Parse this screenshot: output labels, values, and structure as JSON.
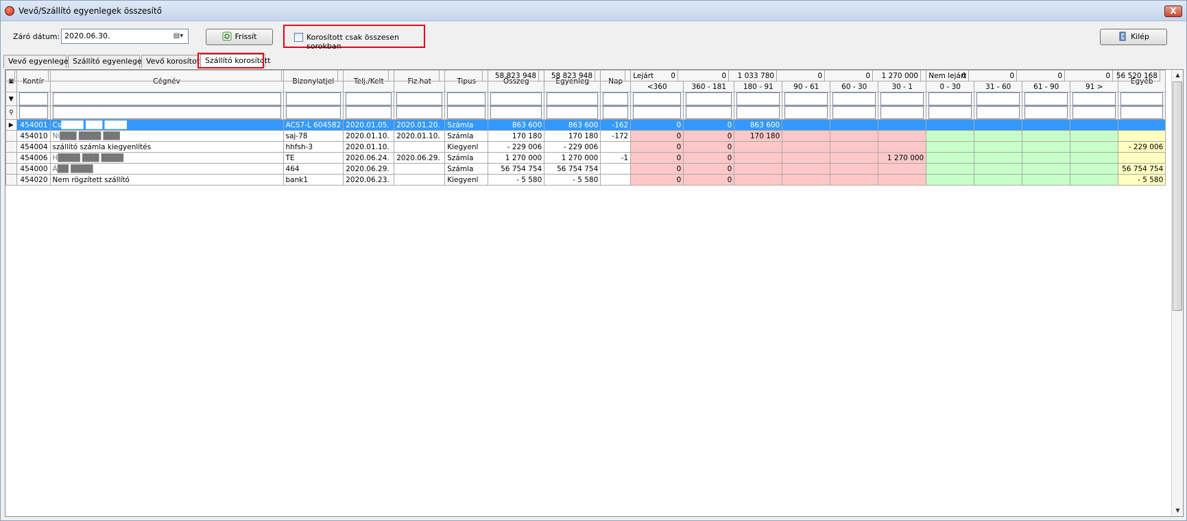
{
  "window": {
    "title": "Vevő/Szállító egyenlegek összesítő",
    "close_label": "X"
  },
  "toolbar": {
    "date_label": "Záró dátum:",
    "date_value": "2020.06.30.",
    "refresh_label": "Frissít",
    "checkbox_label": "Korosított csak összesen sorokban",
    "exit_label": "Kilép"
  },
  "tabs": [
    {
      "label": "Vevő egyenlegek"
    },
    {
      "label": "Szállító egyenlegek"
    },
    {
      "label": "Vevő korosított"
    },
    {
      "label": "Szállító korosított",
      "active": true
    }
  ],
  "grid": {
    "headers": {
      "kontir": "Kontír",
      "cegnev": "Cégnév",
      "bizonylatjel": "Bizonylatjel",
      "telj": "Telj./Kelt",
      "fizhat": "Fiz.hat",
      "tipus": "Tipus",
      "osszeg": "Összeg",
      "egyenleg": "Egyenleg",
      "nap": "Nap",
      "lejart": "Lejárt",
      "nemlejart": "Nem lejárt",
      "egyeb": "Egyéb",
      "l1": "<360",
      "l2": "360 - 181",
      "l3": "180 - 91",
      "l4": "90 - 61",
      "l5": "60 - 30",
      "l6": "30 - 1",
      "n1": "0 - 30",
      "n2": "31 - 60",
      "n3": "61 - 90",
      "n4": "91 >"
    },
    "rows": [
      [
        "454001",
        "Cs████ ███ ████",
        "ACS7-L 604582",
        "2020.01.05.",
        "2020.01.20.",
        "Számla",
        "863 600",
        "863 600",
        "-162",
        "0",
        "0",
        "863 600",
        "",
        "",
        "",
        "",
        "",
        "",
        "",
        ""
      ],
      [
        "454010",
        "Ni███ ████ ███",
        "saj-78",
        "2020.01.10.",
        "2020.01.10.",
        "Számla",
        "170 180",
        "170 180",
        "-172",
        "0",
        "0",
        "170 180",
        "",
        "",
        "",
        "",
        "",
        "",
        "",
        ""
      ],
      [
        "454004",
        "szállító számla kiegyenlítés",
        "hhfsh-3",
        "2020.01.10.",
        "",
        "Kiegyenl",
        "- 229 006",
        "- 229 006",
        "",
        "0",
        "0",
        "",
        "",
        "",
        "",
        "",
        "",
        "",
        "",
        "- 229 006"
      ],
      [
        "454006",
        "H████ ███ ████",
        "TE",
        "2020.06.24.",
        "2020.06.29.",
        "Számla",
        "1 270 000",
        "1 270 000",
        "-1",
        "0",
        "0",
        "",
        "",
        "",
        "1 270 000",
        "",
        "",
        "",
        "",
        ""
      ],
      [
        "454000",
        "Á██ ████",
        "464",
        "2020.06.29.",
        "",
        "Számla",
        "56 754 754",
        "56 754 754",
        "",
        "0",
        "0",
        "",
        "",
        "",
        "",
        "",
        "",
        "",
        "",
        "56 754 754"
      ],
      [
        "454020",
        "Nem rögzített szállító",
        "bank1",
        "2020.06.23.",
        "",
        "Kiegyenl",
        "- 5 580",
        "- 5 580",
        "",
        "0",
        "0",
        "",
        "",
        "",
        "",
        "",
        "",
        "",
        "",
        "- 5 580"
      ]
    ],
    "totals": [
      "58 823 948",
      "58 823 948",
      "",
      "0",
      "0",
      "1 033 780",
      "0",
      "0",
      "1 270 000",
      "0",
      "0",
      "0",
      "0",
      "56 520 168"
    ]
  }
}
